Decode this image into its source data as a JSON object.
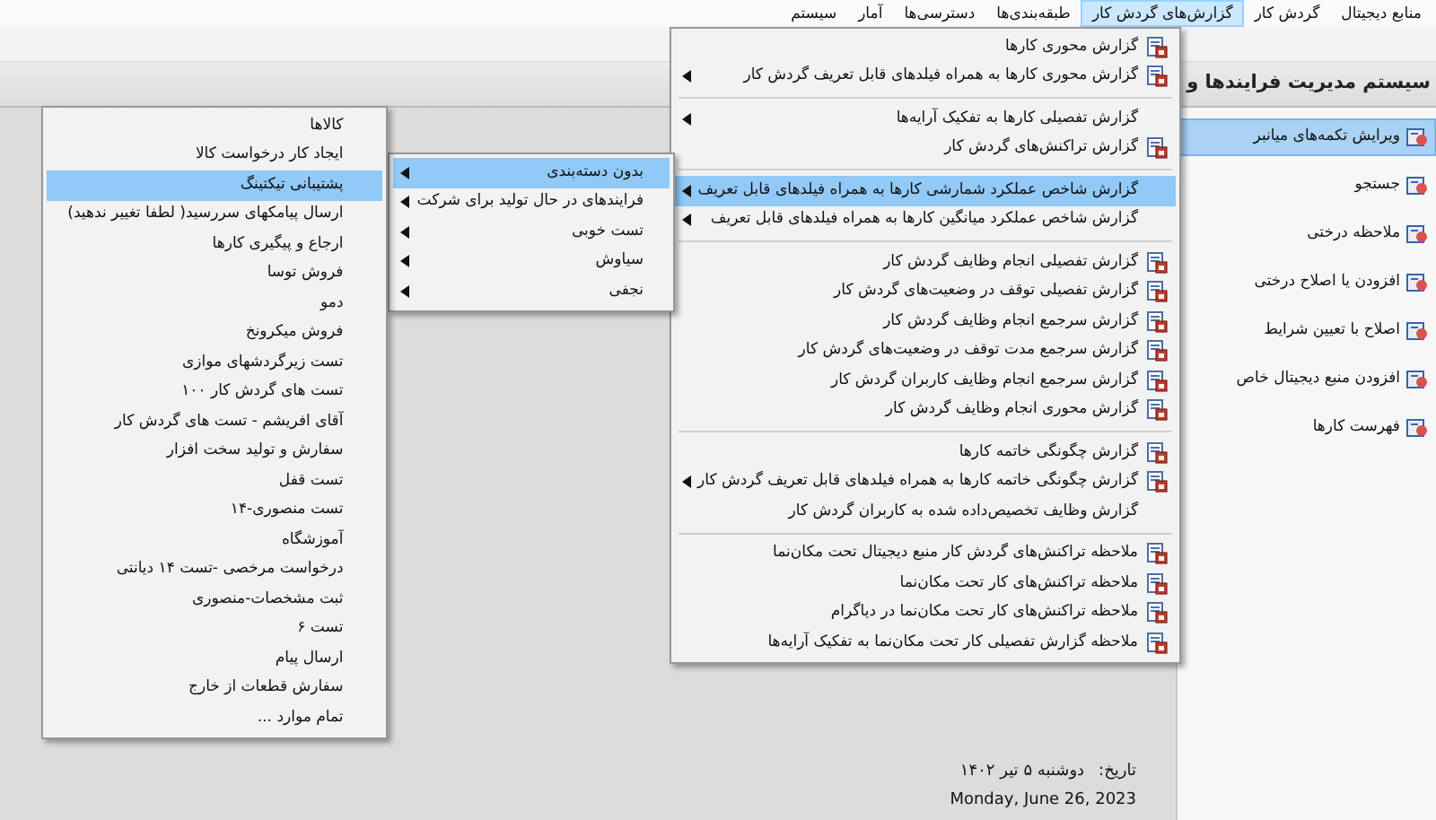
{
  "menubar": [
    {
      "label": "منابع دیجیتال",
      "selected": false
    },
    {
      "label": "گردش کار",
      "selected": false
    },
    {
      "label": "گزارش‌های گردش کار",
      "selected": true
    },
    {
      "label": "طبقه‌بندی‌ها",
      "selected": false
    },
    {
      "label": "دسترسی‌ها",
      "selected": false
    },
    {
      "label": "آمار",
      "selected": false
    },
    {
      "label": "سیستم",
      "selected": false
    }
  ],
  "header_title": "سیستم مدیریت فرایندها و",
  "shortcuts": [
    {
      "label": "ویرایش تکمه‌های میانبر",
      "selected": true
    },
    {
      "label": "جستجو",
      "selected": false
    },
    {
      "label": "ملاحظه درختی",
      "selected": false
    },
    {
      "label": "افزودن یا اصلاح درختی",
      "selected": false
    },
    {
      "label": "اصلاح با تعیین شرایط",
      "selected": false
    },
    {
      "label": "افزودن منبع دیجیتال خاص",
      "selected": false
    },
    {
      "label": "فهرست کارها",
      "selected": false
    }
  ],
  "reports_menu": [
    {
      "kind": "item",
      "label": "گزارش محوری کارها",
      "has_icon": true,
      "submenu": false,
      "selected": false
    },
    {
      "kind": "item",
      "label": "گزارش محوری کارها به همراه فیلدهای قابل تعریف گردش کار",
      "has_icon": true,
      "submenu": true,
      "selected": false
    },
    {
      "kind": "separator"
    },
    {
      "kind": "item",
      "label": "گزارش تفصیلی کارها به تفکیک آرایه‌ها",
      "has_icon": false,
      "submenu": true,
      "selected": false
    },
    {
      "kind": "item",
      "label": "گزارش تراکنش‌های گردش کار",
      "has_icon": true,
      "submenu": false,
      "selected": false
    },
    {
      "kind": "separator"
    },
    {
      "kind": "item",
      "label": "گزارش شاخص عملکرد شمارشی کارها به همراه فیلدهای قابل تعریف",
      "has_icon": false,
      "submenu": true,
      "selected": true
    },
    {
      "kind": "item",
      "label": "گزارش شاخص عملکرد میانگین کارها به همراه فیلدهای قابل تعریف",
      "has_icon": false,
      "submenu": true,
      "selected": false
    },
    {
      "kind": "separator"
    },
    {
      "kind": "item",
      "label": "گزارش تفصیلی انجام وظایف گردش کار",
      "has_icon": true,
      "submenu": false,
      "selected": false
    },
    {
      "kind": "item",
      "label": "گزارش تفصیلی توقف در وضعیت‌های گردش کار",
      "has_icon": true,
      "submenu": false,
      "selected": false
    },
    {
      "kind": "item",
      "label": "گزارش سرجمع انجام وظایف گردش کار",
      "has_icon": true,
      "submenu": false,
      "selected": false
    },
    {
      "kind": "item",
      "label": "گزارش سرجمع مدت توقف در وضعیت‌های گردش کار",
      "has_icon": true,
      "submenu": false,
      "selected": false
    },
    {
      "kind": "item",
      "label": "گزارش سرجمع انجام وظایف کاربران گردش کار",
      "has_icon": true,
      "submenu": false,
      "selected": false
    },
    {
      "kind": "item",
      "label": "گزارش محوری انجام وظایف گردش کار",
      "has_icon": true,
      "submenu": false,
      "selected": false
    },
    {
      "kind": "separator"
    },
    {
      "kind": "item",
      "label": "گزارش چگونگی خاتمه کارها",
      "has_icon": true,
      "submenu": false,
      "selected": false
    },
    {
      "kind": "item",
      "label": "گزارش چگونگی خاتمه کارها به همراه فیلدهای قابل تعریف گردش کار",
      "has_icon": true,
      "submenu": true,
      "selected": false
    },
    {
      "kind": "item",
      "label": "گزارش وظایف تخصیص‌داده شده به کاربران گردش کار",
      "has_icon": false,
      "submenu": false,
      "selected": false
    },
    {
      "kind": "separator"
    },
    {
      "kind": "item",
      "label": "ملاحظه تراکنش‌های گردش کار منبع دیجیتال تحت مکان‌نما",
      "has_icon": true,
      "submenu": false,
      "selected": false
    },
    {
      "kind": "item",
      "label": "ملاحظه تراکنش‌های کار تحت مکان‌نما",
      "has_icon": true,
      "submenu": false,
      "selected": false
    },
    {
      "kind": "item",
      "label": "ملاحظه تراکنش‌های کار تحت مکان‌نما در دیاگرام",
      "has_icon": true,
      "submenu": false,
      "selected": false
    },
    {
      "kind": "item",
      "label": "ملاحظه گزارش تفصیلی کار تحت مکان‌نما به تفکیک آرایه‌ها",
      "has_icon": true,
      "submenu": false,
      "selected": false
    }
  ],
  "category_menu": [
    {
      "label": "بدون دسته‌بندی",
      "selected": true,
      "submenu": true
    },
    {
      "label": "فرایندهای در حال تولید برای شرکت",
      "selected": false,
      "submenu": true
    },
    {
      "label": "تست خوبی",
      "selected": false,
      "submenu": true
    },
    {
      "label": "سیاوش",
      "selected": false,
      "submenu": true
    },
    {
      "label": "نجفی",
      "selected": false,
      "submenu": true
    }
  ],
  "process_menu": [
    {
      "label": "کالاها",
      "selected": false
    },
    {
      "label": "ایجاد کار درخواست کالا",
      "selected": false
    },
    {
      "label": "پشتیبانی تیکتینگ",
      "selected": true
    },
    {
      "label": "ارسال پیامکهای سررسید( لطفا تغییر ندهید)",
      "selected": false
    },
    {
      "label": "ارجاع و پیگیری کارها",
      "selected": false
    },
    {
      "label": "فروش توسا",
      "selected": false
    },
    {
      "label": "دمو",
      "selected": false
    },
    {
      "label": "فروش میکرونخ",
      "selected": false
    },
    {
      "label": "تست زیرگردشهای موازی",
      "selected": false
    },
    {
      "label": "تست های گردش کار ۱۰۰",
      "selected": false
    },
    {
      "label": "آقای افریشم - تست های گردش کار",
      "selected": false
    },
    {
      "label": "سفارش و تولید سخت افزار",
      "selected": false
    },
    {
      "label": "تست قفل",
      "selected": false
    },
    {
      "label": "تست منصوری-۱۴",
      "selected": false
    },
    {
      "label": "آموزشگاه",
      "selected": false
    },
    {
      "label": "درخواست مرخصی -تست ۱۴ دیانتی",
      "selected": false
    },
    {
      "label": "ثبت مشخصات-منصوری",
      "selected": false
    },
    {
      "label": "تست ۶",
      "selected": false
    },
    {
      "label": "ارسال پیام",
      "selected": false
    },
    {
      "label": "سفارش قطعات از خارج",
      "selected": false
    },
    {
      "label": "تمام موارد ...",
      "selected": false
    }
  ],
  "date_info": {
    "date_label": "تاریخ:",
    "persian_date": "دوشنبه ۵ تیر ۱۴۰۲",
    "gregorian_date": "Monday, June 26, 2023"
  }
}
